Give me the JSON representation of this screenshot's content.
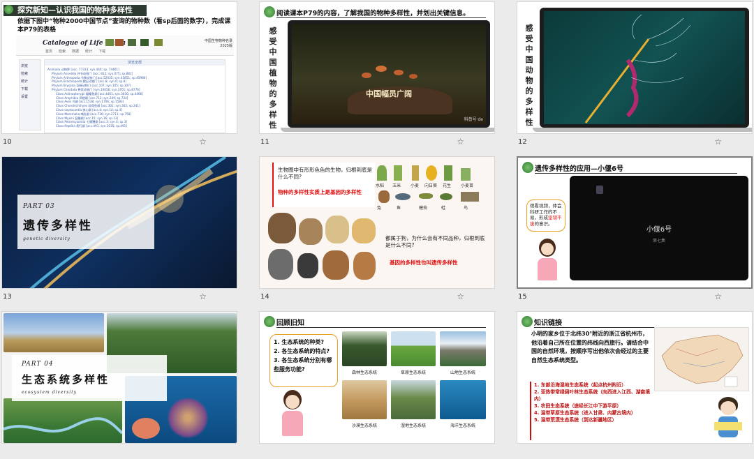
{
  "slides": [
    {
      "num": "10",
      "title": "探究新知—认识我国的物种多样性",
      "subtitle": "依据下图中“物种2000中国节点”查询的物种数（看sp后面的数字），完成课本P79的表格",
      "logo_text": "Catalogue of Life China",
      "year_label": "中国生物物种名录 2025版",
      "menu": [
        "首页",
        "检索",
        "数据",
        "统计",
        "下载"
      ],
      "sidebar": [
        "浏览",
        "检索",
        "统计",
        "下载",
        "设置"
      ],
      "tree_header": "浏览全部",
      "tree_items": [
        "Animalia 动物界 [acc. 77333, syn.440; sp. 74461]",
        "Phylum Annelida 环节动物门 [acc. 812; syn.075; sp.881]",
        "Phylum Arthropoda 节肢动物门 [acc.52035; syn.45851; sp.45986]",
        "Phylum Brachiopoda 腕足动物门 [acc.8; syn.0; sp.8]",
        "Phylum Bryozoa 苔藓动物门 [acc.107; syn.105; sp.107]",
        "Phylum Chordata 脊索动物门 [syn.10656; syn.3701; sp.8776]",
        "Class Actinopterygii 辐鳍鱼纲 [acc.4461; syn.3030; sp.4466]",
        "Class Amphibia 两栖纲 [acc.712; syn.249; sp.724]",
        "Class Aves 鸟纲 [acc.1538; syn.1706; sp.1583]",
        "Class Chondrichthyes 软骨鱼纲 [acc.301; syn.302; sp.241]",
        "Class Leptocardia 狭心纲 [acc.4; syn.14; sp.4]",
        "Class Mammalia 哺乳纲 [acc.736; syn.2711; sp.758]",
        "Class Myxini 盲鳗纲 [acc.15; syn.16; sp.13]",
        "Class Petromyzontia 七鳃鳗纲 [acc.3; syn.4; sp.3]",
        "Class Reptilia 爬行纲 [acc.491; syn.1035; sp.491]"
      ]
    },
    {
      "num": "11",
      "title": "阅读课本P79的内容，了解我国的物种多样性，并划出关键信息。",
      "side_text": "感受中国植物的多样性",
      "caption": "中国幅员广阔",
      "watermark": "科普号·de"
    },
    {
      "num": "12",
      "side_text": "感受中国动物的多样性"
    },
    {
      "num": "13",
      "part": "PART 03",
      "heading": "遗传多样性",
      "en": "genetic diversity"
    },
    {
      "num": "14",
      "q1": "生物圈中有形形色色的生物，归根到底是什么不同?",
      "a1": "物种的多样性实质上是基因的多样性",
      "q2": "都属于狗，为什么会有不同品种，归根到底是什么不同?",
      "a2": "基因的多样性也叫遗传多样性",
      "organisms": [
        "水稻",
        "玉米",
        "小麦",
        "向日葵",
        "花生",
        "小麦苗",
        "兔",
        "鱼",
        "蝗虫",
        "蛙",
        "鸟"
      ]
    },
    {
      "num": "15",
      "title": "遗传多样性的应用—小偃6号",
      "bubble": [
        "观看视频，体会科研工作的不易，形成",
        "坚韧不拔",
        "的意识。"
      ],
      "video_title": "小偃6号",
      "video_sub": "第七集"
    },
    {
      "num": "16",
      "part": "PART 04",
      "heading": "生态系统多样性",
      "en": "ecosystem diversity"
    },
    {
      "num": "17",
      "title": "回顾旧知",
      "questions": [
        "1. 生态系统的种类?",
        "2. 各生态系统的特点?",
        "3. 各生态系统分别有哪些服务功能?"
      ],
      "ecosystems": [
        "森林生态系统",
        "草原生态系统",
        "山地生态系统",
        "沙漠生态系统",
        "湿地生态系统",
        "海洋生态系统"
      ]
    },
    {
      "num": "18",
      "title": "知识链接",
      "text": "小明的家乡位于北纬30°附近的浙江省杭州市，他沿着自己所在位置的纬线向西旅行。请结合中国的自然环境，按顺序写出他依次会经过的主要自然生态系统类型。",
      "answers": [
        "1. 东部沿海湿地生态系统（起点杭州附近）",
        "2. 亚热带常绿阔叶林生态系统（向西进入江西、湖南境内）",
        "3. 农田生态系统（途经长江中下游平原）",
        "4. 温带草原生态系统（进入甘肃、内蒙古境内）",
        "5. 温带荒漠生态系统（到达新疆地区）"
      ]
    }
  ],
  "colors": {
    "accent_red": "#e01010",
    "title_dark": "#2d3a2f",
    "selection_border": "#7d7d7d"
  }
}
